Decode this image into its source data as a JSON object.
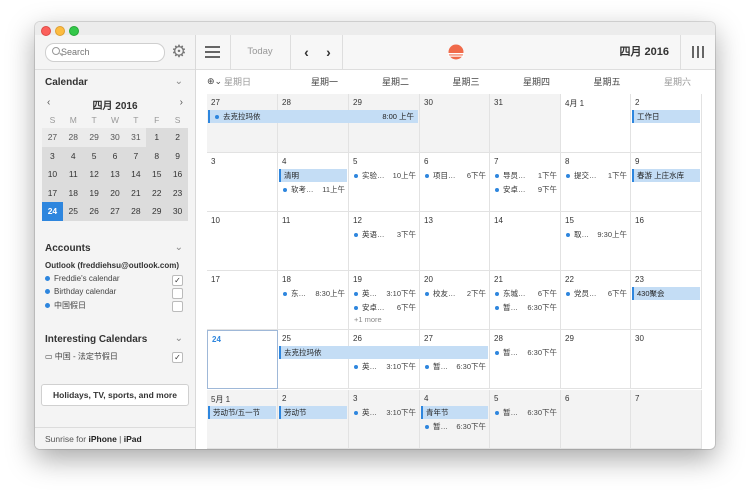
{
  "sidebar": {
    "search_placeholder": "Search",
    "calendar_title": "Calendar",
    "mini_month": "四月 2016",
    "weekdays": [
      "S",
      "M",
      "T",
      "W",
      "T",
      "F",
      "S"
    ],
    "weeks": [
      [
        "27",
        "28",
        "29",
        "30",
        "31",
        "1",
        "2"
      ],
      [
        "3",
        "4",
        "5",
        "6",
        "7",
        "8",
        "9"
      ],
      [
        "10",
        "11",
        "12",
        "13",
        "14",
        "15",
        "16"
      ],
      [
        "17",
        "18",
        "19",
        "20",
        "21",
        "22",
        "23"
      ],
      [
        "24",
        "25",
        "26",
        "27",
        "28",
        "29",
        "30"
      ]
    ],
    "accounts_title": "Accounts",
    "account_owner": "Outlook (freddiehsu@outlook.com)",
    "accounts": [
      {
        "label": "Freddie's calendar",
        "checked": "✓"
      },
      {
        "label": "Birthday calendar",
        "checked": ""
      },
      {
        "label": "中国假日",
        "checked": ""
      }
    ],
    "interesting_title": "Interesting Calendars",
    "interesting": [
      {
        "label": "中国 - 法定节假日",
        "checked": "✓"
      }
    ],
    "more_button": "Holidays, TV, sports, and more",
    "footer_prefix": "Sunrise for ",
    "footer_iphone": "iPhone",
    "footer_sep": " | ",
    "footer_ipad": "iPad"
  },
  "toolbar": {
    "today_label": "Today",
    "prev_label": "‹",
    "next_label": "›",
    "month_title": "四月 2016",
    "accent": "#f06a4a"
  },
  "calendar": {
    "day_headers": [
      "星期日",
      "星期一",
      "星期二",
      "星期三",
      "星期四",
      "星期五",
      "星期六"
    ],
    "weeks": [
      {
        "days": [
          "27",
          "28",
          "29",
          "30",
          "31",
          "4月 1",
          "2"
        ]
      },
      {
        "days": [
          "3",
          "4",
          "5",
          "6",
          "7",
          "8",
          "9"
        ]
      },
      {
        "days": [
          "10",
          "11",
          "12",
          "13",
          "14",
          "15",
          "16"
        ]
      },
      {
        "days": [
          "17",
          "18",
          "19",
          "20",
          "21",
          "22",
          "23"
        ]
      },
      {
        "days": [
          "24",
          "25",
          "26",
          "27",
          "28",
          "29",
          "30"
        ]
      },
      {
        "days": [
          "5月 1",
          "2",
          "3",
          "4",
          "5",
          "6",
          "7"
        ]
      }
    ],
    "bars": [
      {
        "week": 0,
        "start": 0,
        "span": 3,
        "row": 0,
        "title": "去克拉玛依",
        "time": "8:00 上午",
        "dot": true
      },
      {
        "week": 0,
        "start": 6,
        "span": 1,
        "row": 0,
        "title": "工作日",
        "time": "",
        "dot": false
      },
      {
        "week": 1,
        "start": 1,
        "span": 1,
        "row": 0,
        "title": "清明",
        "time": "",
        "dot": false
      },
      {
        "week": 1,
        "start": 6,
        "span": 1,
        "row": 0,
        "title": "春游 上庄水库",
        "time": "",
        "dot": false
      },
      {
        "week": 3,
        "start": 6,
        "span": 1,
        "row": 0,
        "title": "430聚会",
        "time": "",
        "dot": false
      },
      {
        "week": 4,
        "start": 1,
        "span": 3,
        "row": 0,
        "title": "去克拉玛依",
        "time": "",
        "dot": false
      },
      {
        "week": 5,
        "start": 0,
        "span": 1,
        "row": 0,
        "title": "劳动节/五一节",
        "time": "",
        "dot": false
      },
      {
        "week": 5,
        "start": 1,
        "span": 1,
        "row": 0,
        "title": "劳动节",
        "time": "",
        "dot": false
      },
      {
        "week": 5,
        "start": 3,
        "span": 1,
        "row": 0,
        "title": "青年节",
        "time": "",
        "dot": false
      }
    ],
    "events": [
      {
        "week": 1,
        "day": 1,
        "row": 1,
        "title": "软考…",
        "time": "11上午"
      },
      {
        "week": 1,
        "day": 2,
        "row": 0,
        "title": "实验…",
        "time": "10上午"
      },
      {
        "week": 1,
        "day": 3,
        "row": 0,
        "title": "项目…",
        "time": "6下午"
      },
      {
        "week": 1,
        "day": 4,
        "row": 0,
        "title": "导员…",
        "time": "1下午"
      },
      {
        "week": 1,
        "day": 4,
        "row": 1,
        "title": "安卓…",
        "time": "9下午"
      },
      {
        "week": 1,
        "day": 5,
        "row": 0,
        "title": "提交…",
        "time": "1下午"
      },
      {
        "week": 2,
        "day": 2,
        "row": 0,
        "title": "英语…",
        "time": "3下午"
      },
      {
        "week": 2,
        "day": 5,
        "row": 0,
        "title": "取…",
        "time": "9:30上午"
      },
      {
        "week": 3,
        "day": 1,
        "row": 0,
        "title": "东…",
        "time": "8:30上午"
      },
      {
        "week": 3,
        "day": 2,
        "row": 0,
        "title": "英…",
        "time": "3:10下午"
      },
      {
        "week": 3,
        "day": 2,
        "row": 1,
        "title": "安卓…",
        "time": "6下午"
      },
      {
        "week": 3,
        "day": 3,
        "row": 0,
        "title": "校友…",
        "time": "2下午"
      },
      {
        "week": 3,
        "day": 4,
        "row": 0,
        "title": "东城…",
        "time": "6下午"
      },
      {
        "week": 3,
        "day": 4,
        "row": 1,
        "title": "暂…",
        "time": "6:30下午"
      },
      {
        "week": 3,
        "day": 5,
        "row": 0,
        "title": "党员…",
        "time": "6下午"
      },
      {
        "week": 4,
        "day": 2,
        "row": 1,
        "title": "英…",
        "time": "3:10下午"
      },
      {
        "week": 4,
        "day": 3,
        "row": 1,
        "title": "暂…",
        "time": "6:30下午"
      },
      {
        "week": 4,
        "day": 4,
        "row": 0,
        "title": "暂…",
        "time": "6:30下午"
      },
      {
        "week": 5,
        "day": 2,
        "row": 0,
        "title": "英…",
        "time": "3:10下午"
      },
      {
        "week": 5,
        "day": 3,
        "row": 1,
        "title": "暂…",
        "time": "6:30下午"
      },
      {
        "week": 5,
        "day": 4,
        "row": 0,
        "title": "暂…",
        "time": "6:30下午"
      }
    ],
    "more_links": [
      {
        "week": 3,
        "day": 2,
        "label": "+1 more"
      }
    ]
  }
}
